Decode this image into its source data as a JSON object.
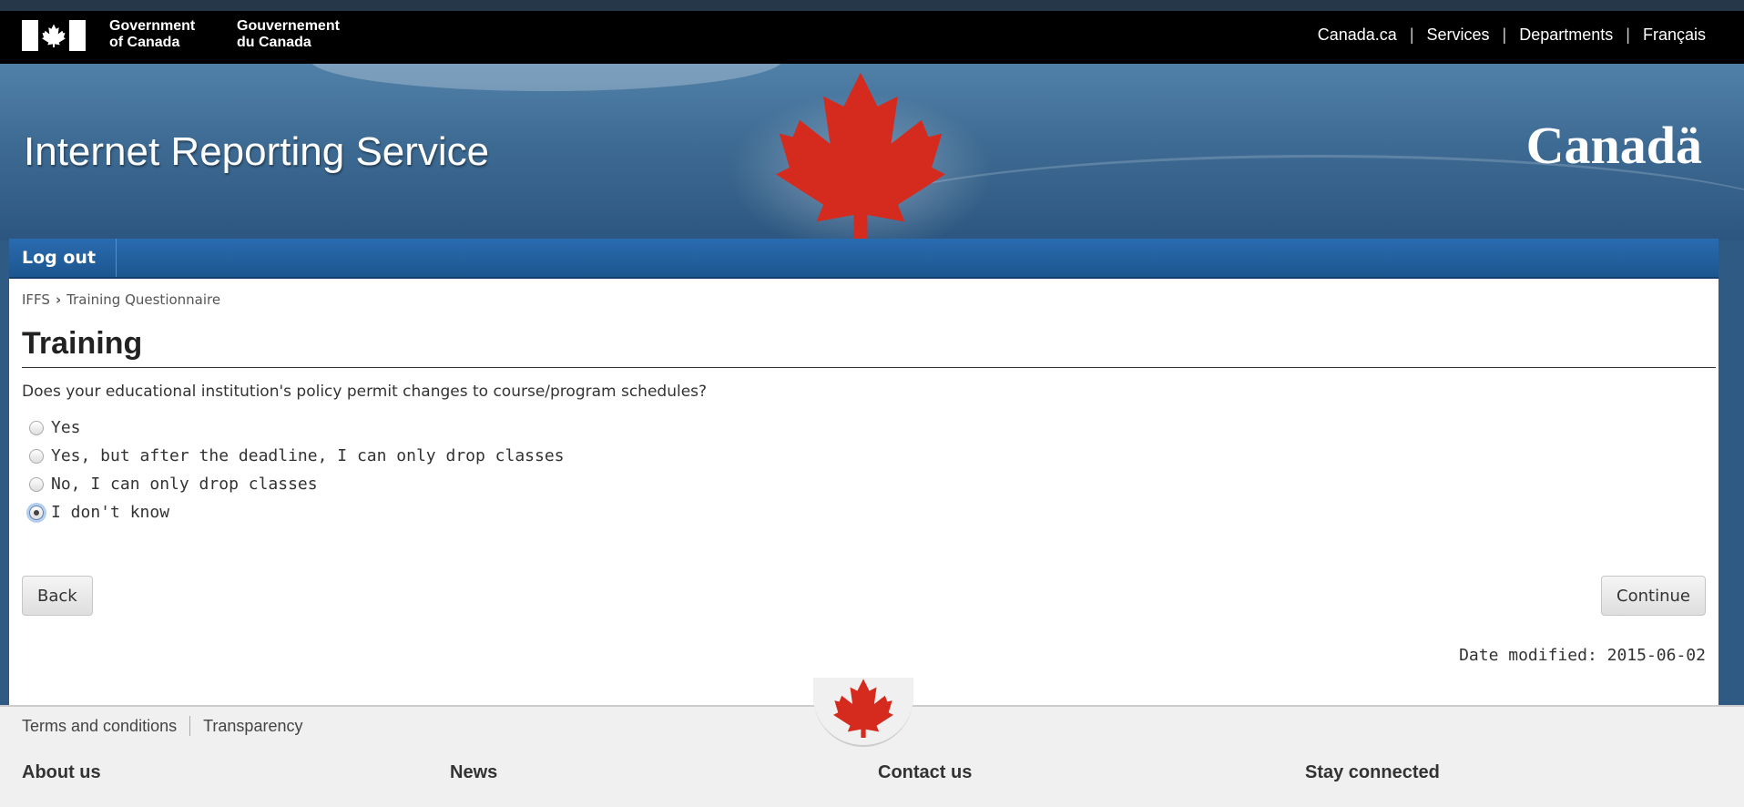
{
  "fip": {
    "gov_en_line1": "Government",
    "gov_en_line2": "of Canada",
    "gov_fr_line1": "Gouvernement",
    "gov_fr_line2": "du Canada",
    "links": {
      "canada": "Canada.ca",
      "services": "Services",
      "departments": "Departments",
      "francais": "Français"
    }
  },
  "banner": {
    "title": "Internet Reporting Service",
    "wordmark": "Canadä"
  },
  "menu": {
    "logout": "Log out"
  },
  "breadcrumb": {
    "home": "IFFS",
    "separator": "›",
    "current": "Training Questionnaire"
  },
  "page": {
    "title": "Training",
    "question": "Does your educational institution's policy permit changes to course/program schedules?",
    "options": [
      {
        "label": "Yes",
        "checked": false
      },
      {
        "label": "Yes, but after the deadline, I can only drop classes",
        "checked": false
      },
      {
        "label": "No, I can only drop classes",
        "checked": false
      },
      {
        "label": "I don't know",
        "checked": true
      }
    ],
    "back_label": "Back",
    "continue_label": "Continue",
    "date_modified": "Date modified: 2015-06-02"
  },
  "footer": {
    "terms": "Terms and conditions",
    "transparency": "Transparency",
    "headings": {
      "about": "About us",
      "news": "News",
      "contact": "Contact us",
      "stay": "Stay connected"
    }
  },
  "colors": {
    "menu_blue": "#1c568f",
    "leaf_red": "#d52b1e",
    "banner_blue": "#3e6b93"
  }
}
